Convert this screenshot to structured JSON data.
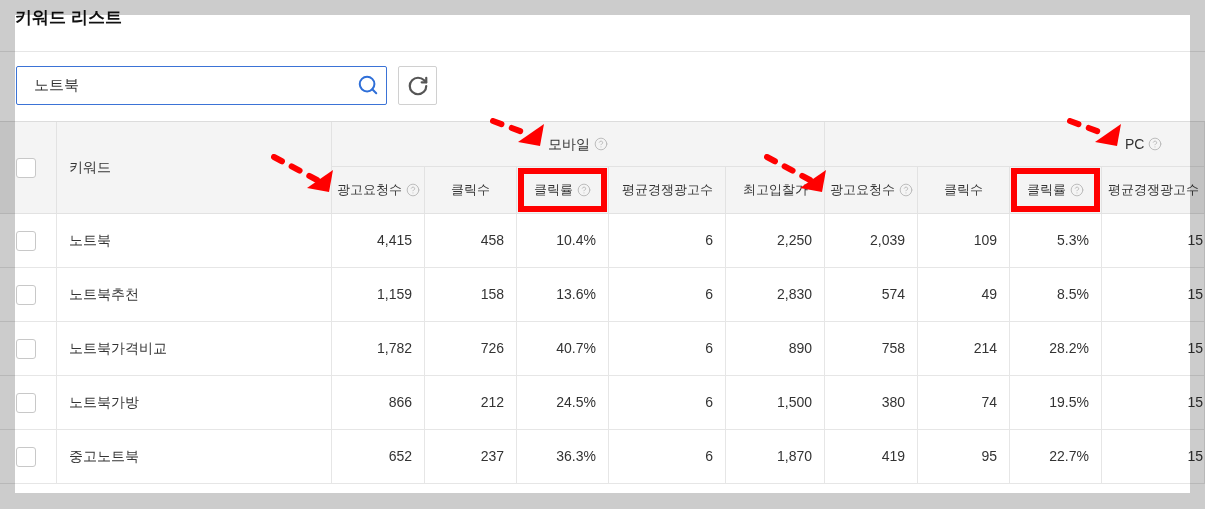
{
  "title": "키워드 리스트",
  "search": {
    "value": "노트북"
  },
  "table": {
    "select_all": {
      "checked": false
    },
    "keyword_header": "키워드",
    "groups": [
      {
        "label": "모바일",
        "help": true,
        "arrow": true
      },
      {
        "label": "PC",
        "help": true,
        "arrow": true
      }
    ],
    "columns": [
      {
        "label": "광고요청수",
        "help": true,
        "arrow": true,
        "highlighted": false
      },
      {
        "label": "클릭수",
        "help": false,
        "arrow": false,
        "highlighted": false
      },
      {
        "label": "클릭률",
        "help": true,
        "arrow": false,
        "highlighted": true
      },
      {
        "label": "평균경쟁광고수",
        "help": false,
        "arrow": false,
        "highlighted": false
      },
      {
        "label": "최고입찰가",
        "help": false,
        "arrow": false,
        "highlighted": false
      },
      {
        "label": "광고요청수",
        "help": true,
        "arrow": true,
        "highlighted": false
      },
      {
        "label": "클릭수",
        "help": false,
        "arrow": false,
        "highlighted": false
      },
      {
        "label": "클릭률",
        "help": true,
        "arrow": false,
        "highlighted": true
      },
      {
        "label": "평균경쟁광고수",
        "help": false,
        "arrow": false,
        "highlighted": false
      }
    ],
    "rows": [
      {
        "checked": false,
        "keyword": "노트북",
        "cells": [
          "4,415",
          "458",
          "10.4%",
          "6",
          "2,250",
          "2,039",
          "109",
          "5.3%",
          "15"
        ]
      },
      {
        "checked": false,
        "keyword": "노트북추천",
        "cells": [
          "1,159",
          "158",
          "13.6%",
          "6",
          "2,830",
          "574",
          "49",
          "8.5%",
          "15"
        ]
      },
      {
        "checked": false,
        "keyword": "노트북가격비교",
        "cells": [
          "1,782",
          "726",
          "40.7%",
          "6",
          "890",
          "758",
          "214",
          "28.2%",
          "15"
        ]
      },
      {
        "checked": false,
        "keyword": "노트북가방",
        "cells": [
          "866",
          "212",
          "24.5%",
          "6",
          "1,500",
          "380",
          "74",
          "19.5%",
          "15"
        ]
      },
      {
        "checked": false,
        "keyword": "중고노트북",
        "cells": [
          "652",
          "237",
          "36.3%",
          "6",
          "1,870",
          "419",
          "95",
          "22.7%",
          "15"
        ]
      }
    ]
  }
}
